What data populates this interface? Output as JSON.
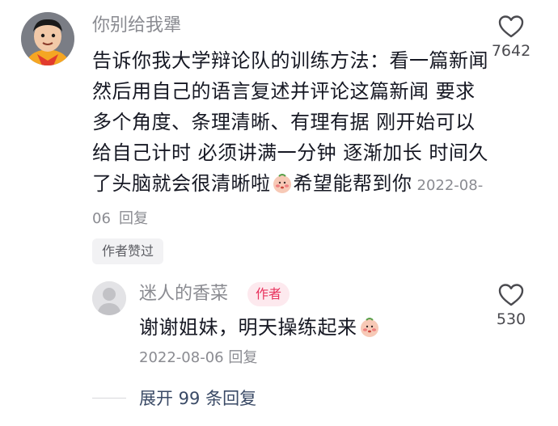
{
  "main_comment": {
    "username": "你别给我犟",
    "text": "告诉你我大学辩论队的训练方法：看一篇新闻 然后用自己的语言复述并评论这篇新闻 要求多个角度、条理清晰、有理有据 刚开始可以给自己计时 必须讲满一分钟 逐渐加长 时间久了头脑就会很清晰啦",
    "text_after_emoji": "希望能帮到你",
    "date": "2022-08-06",
    "reply_label": "回复",
    "like_count": "7642",
    "author_liked_label": "作者赞过"
  },
  "reply": {
    "username": "迷人的香菜",
    "author_badge": "作者",
    "text": "谢谢姐妹，明天操练起来",
    "date": "2022-08-06",
    "reply_label": "回复",
    "like_count": "530"
  },
  "expand": {
    "label": "展开 99 条回复"
  },
  "colors": {
    "badge_bg": "#fde9ee",
    "badge_text": "#e8335d",
    "expand_text": "#3a4a66"
  }
}
